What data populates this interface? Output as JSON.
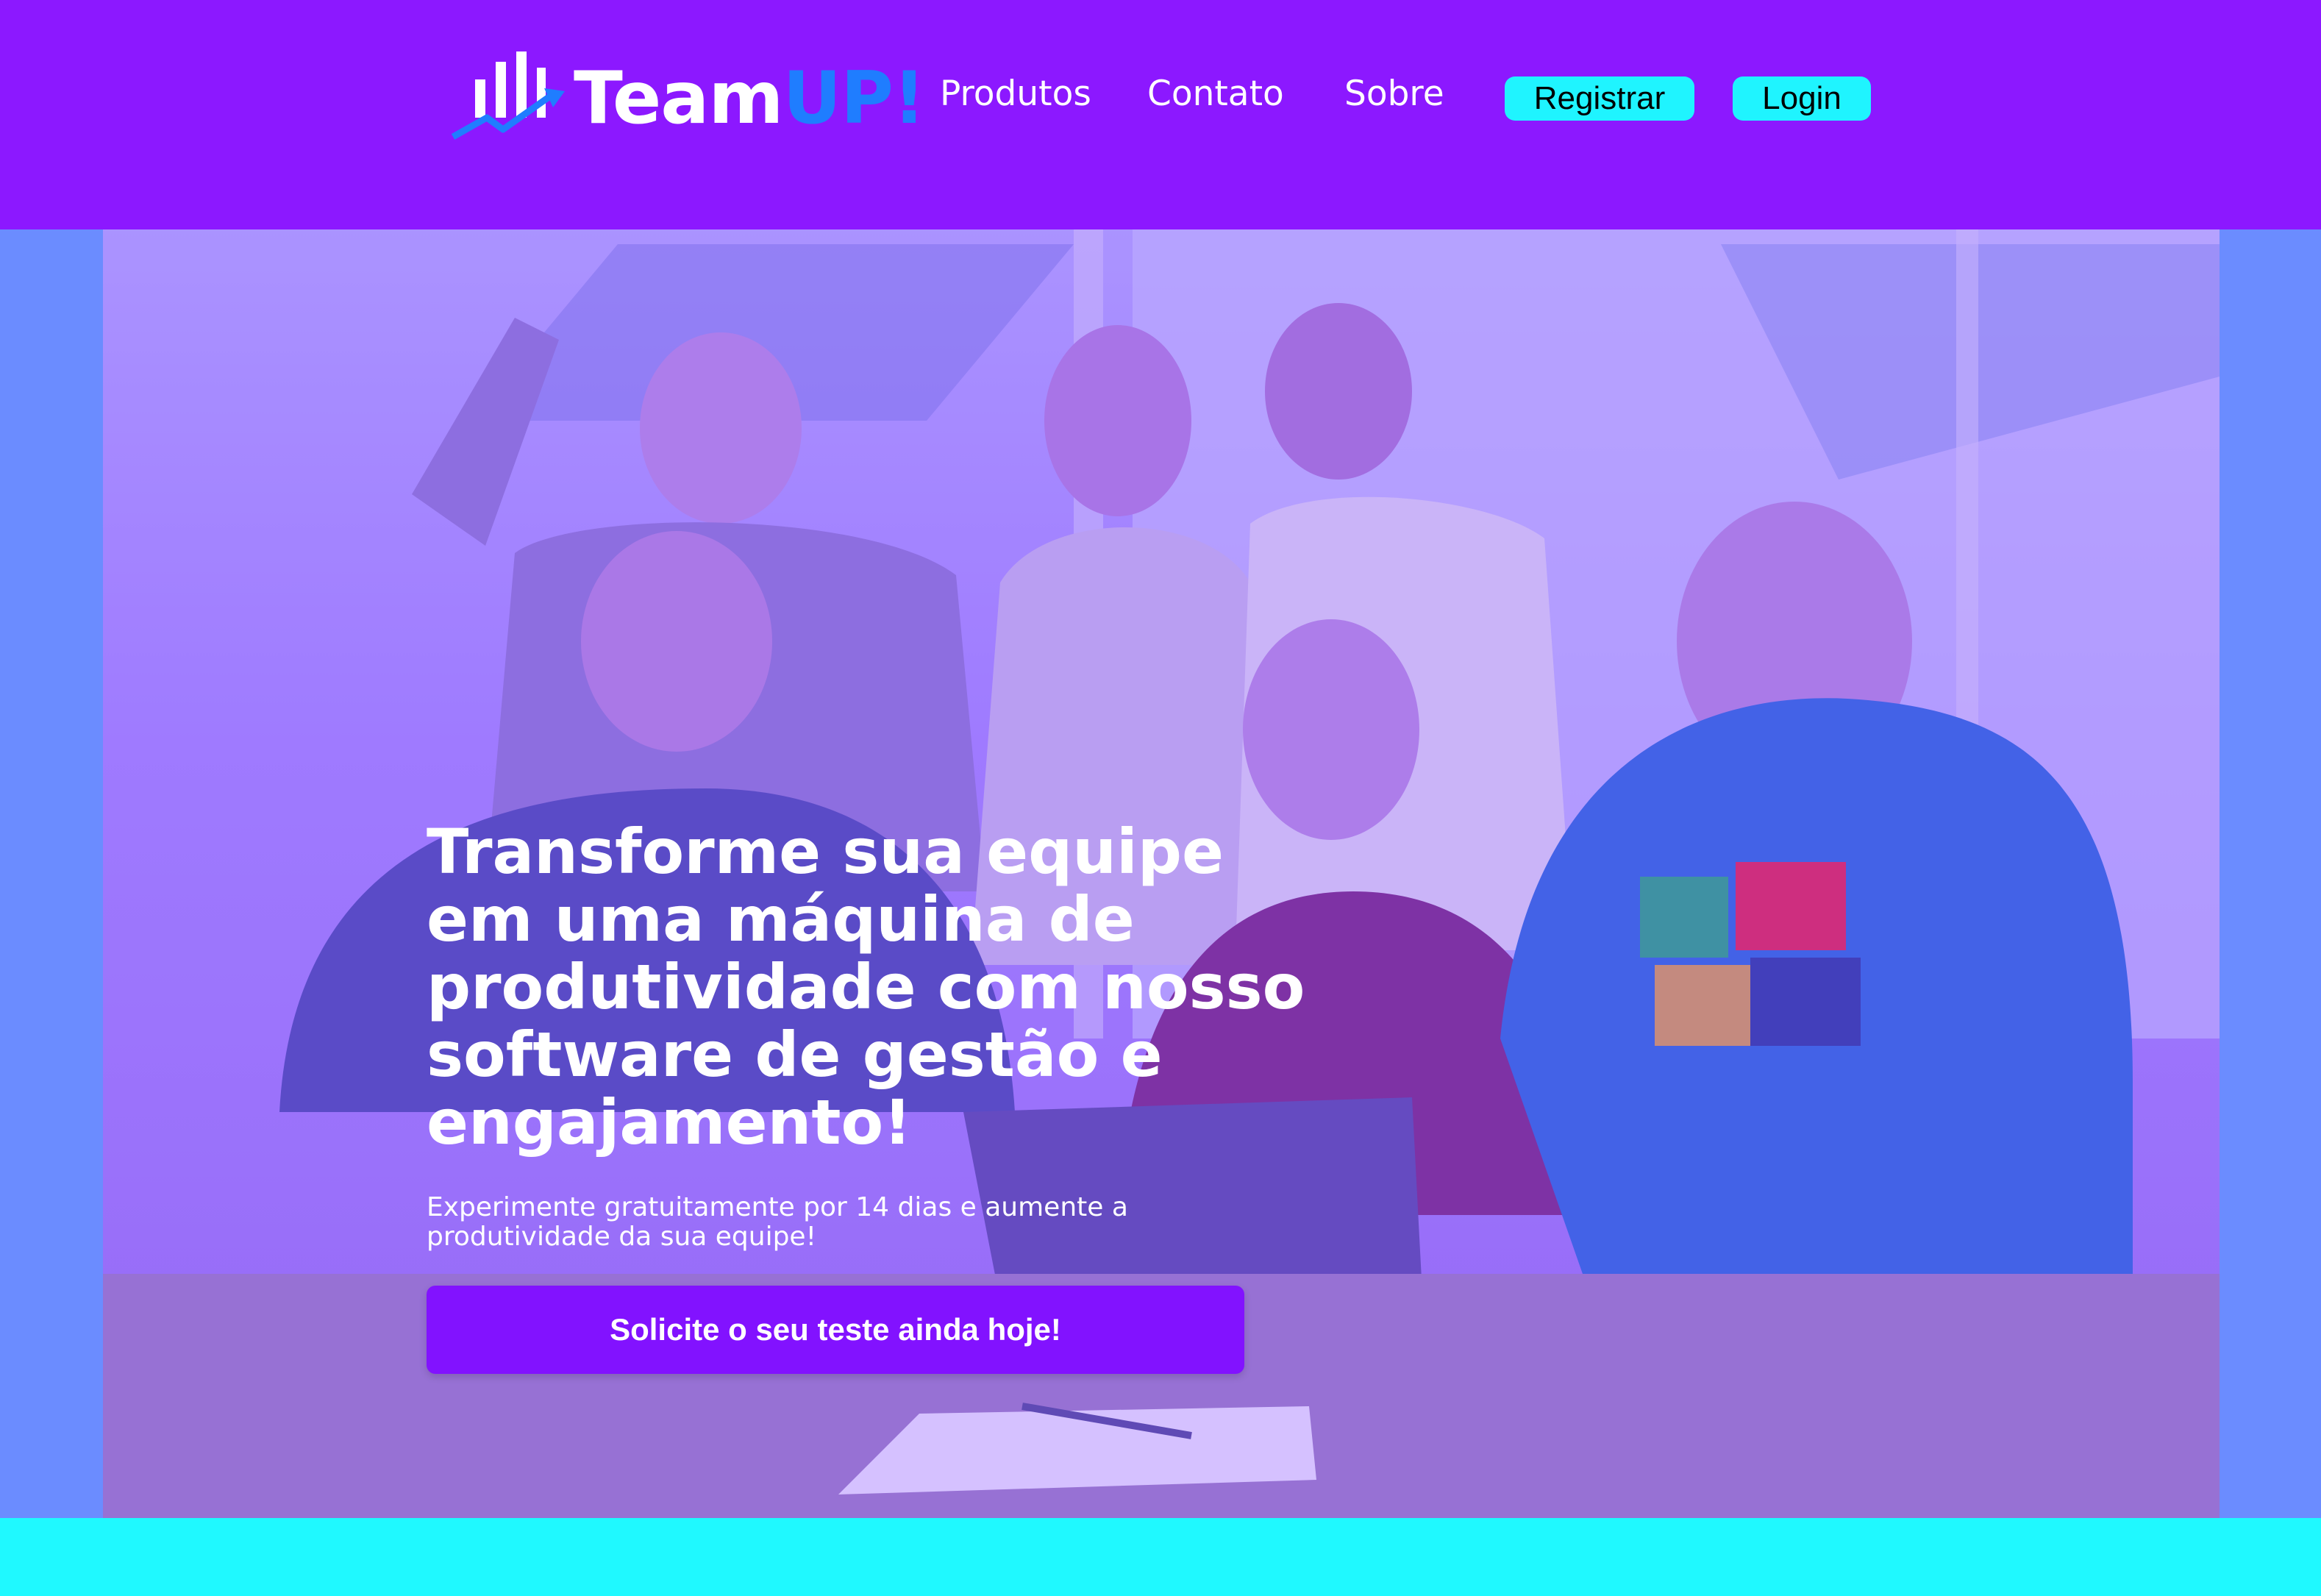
{
  "header": {
    "logo": {
      "text_main": "Team",
      "text_accent": "UP!",
      "icon": "bar-chart-icon"
    },
    "nav": [
      {
        "label": "Produtos"
      },
      {
        "label": "Contato"
      },
      {
        "label": "Sobre"
      }
    ],
    "register_label": "Registrar",
    "login_label": "Login"
  },
  "hero": {
    "image": "team-celebrating-photo",
    "headline": "Transforme sua equipe em uma máquina de produtividade com nosso software de gestão e engajamento!",
    "subtext": "Experimente gratuitamente por 14 dias e aumente a produtividade da sua equipe!",
    "cta_label": "Solicite o seu teste ainda hoje!"
  },
  "colors": {
    "header_bg": "#8c18ff",
    "side_bg": "#6b8cff",
    "accent_cyan": "#1ff4ff",
    "cta_bg": "#8212ff",
    "logo_accent": "#1f7dff"
  }
}
